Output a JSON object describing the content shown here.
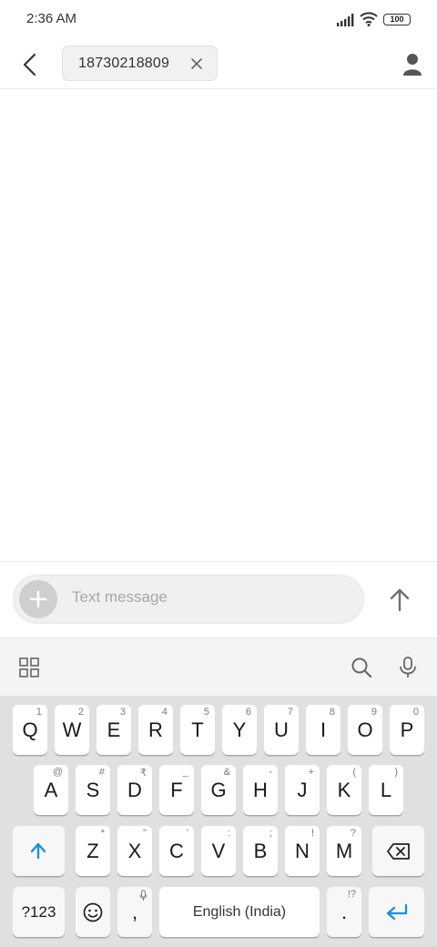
{
  "status_bar": {
    "time": "2:36 AM",
    "battery": "100"
  },
  "header": {
    "recipient": "18730218809"
  },
  "compose": {
    "placeholder": "Text message"
  },
  "keyboard": {
    "rows": [
      [
        {
          "label": "Q",
          "hint": "1"
        },
        {
          "label": "W",
          "hint": "2"
        },
        {
          "label": "E",
          "hint": "3"
        },
        {
          "label": "R",
          "hint": "4"
        },
        {
          "label": "T",
          "hint": "5"
        },
        {
          "label": "Y",
          "hint": "6"
        },
        {
          "label": "U",
          "hint": "7"
        },
        {
          "label": "I",
          "hint": "8"
        },
        {
          "label": "O",
          "hint": "9"
        },
        {
          "label": "P",
          "hint": "0"
        }
      ],
      [
        {
          "label": "A",
          "hint": "@"
        },
        {
          "label": "S",
          "hint": "#"
        },
        {
          "label": "D",
          "hint": "₹"
        },
        {
          "label": "F",
          "hint": "_"
        },
        {
          "label": "G",
          "hint": "&"
        },
        {
          "label": "H",
          "hint": "-"
        },
        {
          "label": "J",
          "hint": "+"
        },
        {
          "label": "K",
          "hint": "("
        },
        {
          "label": "L",
          "hint": ")"
        }
      ],
      [
        {
          "label": "Z",
          "hint": "*"
        },
        {
          "label": "X",
          "hint": "\""
        },
        {
          "label": "C",
          "hint": "'"
        },
        {
          "label": "V",
          "hint": ":"
        },
        {
          "label": "B",
          "hint": ";"
        },
        {
          "label": "N",
          "hint": "!"
        },
        {
          "label": "M",
          "hint": "?"
        }
      ]
    ],
    "symbols_label": "?123",
    "comma_label": ",",
    "space_label": "English (India)",
    "period_label": ".",
    "period_hint": "!?"
  }
}
